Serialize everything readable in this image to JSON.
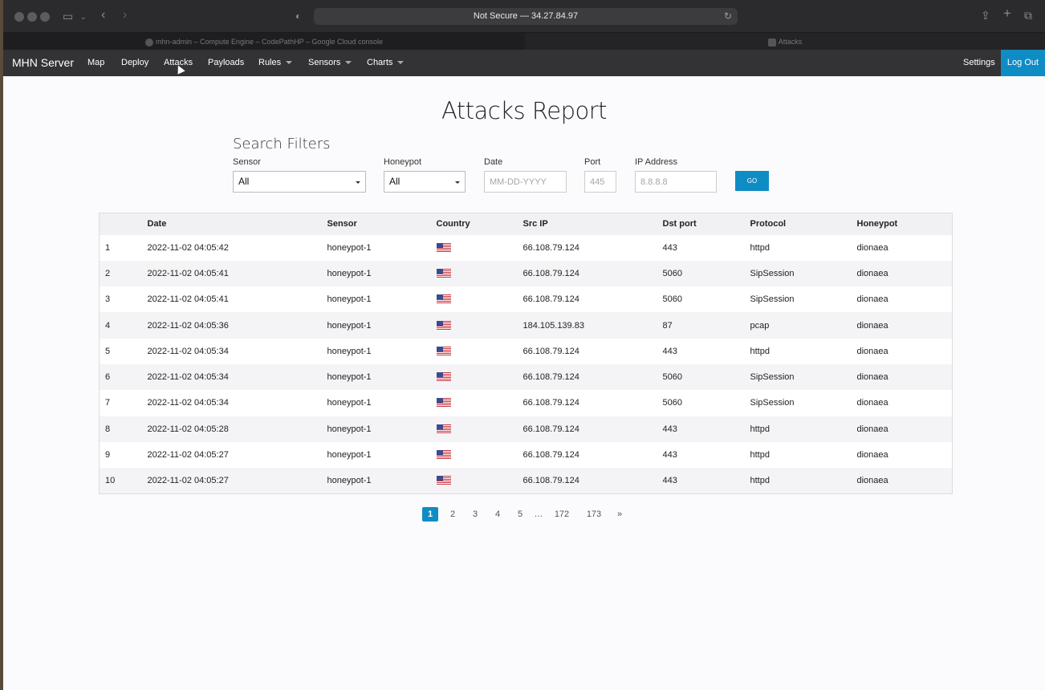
{
  "browser": {
    "url": "Not Secure — 34.27.84.97",
    "tabs": [
      {
        "label": "mhn-admin – Compute Engine – CodePathHP – Google Cloud console"
      },
      {
        "label": "Attacks"
      }
    ]
  },
  "navbar": {
    "brand": "MHN Server",
    "items": [
      "Map",
      "Deploy",
      "Attacks",
      "Payloads",
      "Rules",
      "Sensors",
      "Charts"
    ],
    "settings": "Settings",
    "logout": "Log Out"
  },
  "page": {
    "title": "Attacks Report",
    "filters_title": "Search Filters",
    "filters": {
      "sensor_label": "Sensor",
      "sensor_value": "All",
      "honeypot_label": "Honeypot",
      "honeypot_value": "All",
      "date_label": "Date",
      "date_placeholder": "MM-DD-YYYY",
      "port_label": "Port",
      "port_placeholder": "445",
      "ip_label": "IP Address",
      "ip_placeholder": "8.8.8.8",
      "go_label": "GO"
    }
  },
  "table": {
    "headers": [
      "",
      "Date",
      "Sensor",
      "Country",
      "Src IP",
      "Dst port",
      "Protocol",
      "Honeypot"
    ],
    "rows": [
      [
        "1",
        "2022-11-02 04:05:42",
        "honeypot-1",
        "us-flag",
        "66.108.79.124",
        "443",
        "httpd",
        "dionaea"
      ],
      [
        "2",
        "2022-11-02 04:05:41",
        "honeypot-1",
        "us-flag",
        "66.108.79.124",
        "5060",
        "SipSession",
        "dionaea"
      ],
      [
        "3",
        "2022-11-02 04:05:41",
        "honeypot-1",
        "us-flag",
        "66.108.79.124",
        "5060",
        "SipSession",
        "dionaea"
      ],
      [
        "4",
        "2022-11-02 04:05:36",
        "honeypot-1",
        "us-flag",
        "184.105.139.83",
        "87",
        "pcap",
        "dionaea"
      ],
      [
        "5",
        "2022-11-02 04:05:34",
        "honeypot-1",
        "us-flag",
        "66.108.79.124",
        "443",
        "httpd",
        "dionaea"
      ],
      [
        "6",
        "2022-11-02 04:05:34",
        "honeypot-1",
        "us-flag",
        "66.108.79.124",
        "5060",
        "SipSession",
        "dionaea"
      ],
      [
        "7",
        "2022-11-02 04:05:34",
        "honeypot-1",
        "us-flag",
        "66.108.79.124",
        "5060",
        "SipSession",
        "dionaea"
      ],
      [
        "8",
        "2022-11-02 04:05:28",
        "honeypot-1",
        "us-flag",
        "66.108.79.124",
        "443",
        "httpd",
        "dionaea"
      ],
      [
        "9",
        "2022-11-02 04:05:27",
        "honeypot-1",
        "us-flag",
        "66.108.79.124",
        "443",
        "httpd",
        "dionaea"
      ],
      [
        "10",
        "2022-11-02 04:05:27",
        "honeypot-1",
        "us-flag",
        "66.108.79.124",
        "443",
        "httpd",
        "dionaea"
      ]
    ]
  },
  "pagination": [
    "1",
    "2",
    "3",
    "4",
    "5",
    "…",
    "172",
    "173",
    "»"
  ],
  "colors": {
    "accent": "#108cc4",
    "navbar": "#333335"
  }
}
